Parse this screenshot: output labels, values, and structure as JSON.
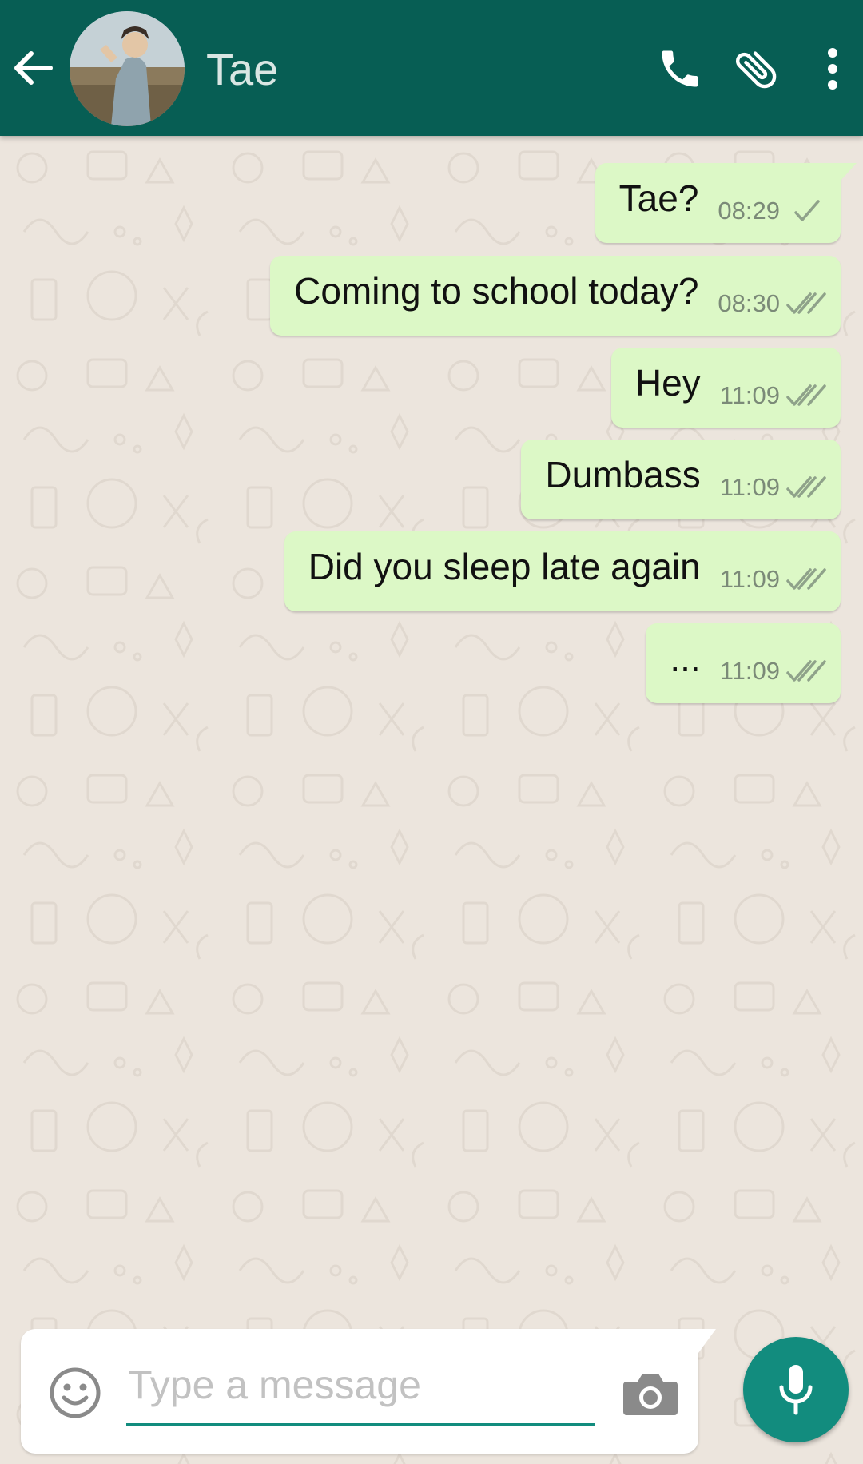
{
  "header": {
    "contact_name": "Tae",
    "background_color": "#075e54"
  },
  "messages": [
    {
      "text": "Tae?",
      "time": "08:29",
      "status": "sent"
    },
    {
      "text": "Coming to school today?",
      "time": "08:30",
      "status": "delivered"
    },
    {
      "text": "Hey",
      "time": "11:09",
      "status": "delivered"
    },
    {
      "text": "Dumbass",
      "time": "11:09",
      "status": "delivered"
    },
    {
      "text": "Did you sleep late again",
      "time": "11:09",
      "status": "delivered"
    },
    {
      "text": "...",
      "time": "11:09",
      "status": "delivered"
    }
  ],
  "composer": {
    "placeholder": "Type a message",
    "value": ""
  },
  "colors": {
    "outgoing_bubble": "#dcf8c6",
    "accent": "#128c7e",
    "chat_background": "#ece5dd"
  },
  "icons": {
    "back": "arrow-left-icon",
    "call": "phone-icon",
    "attach": "paperclip-icon",
    "menu": "more-vertical-icon",
    "emoji": "smiley-icon",
    "camera": "camera-icon",
    "mic": "microphone-icon"
  }
}
